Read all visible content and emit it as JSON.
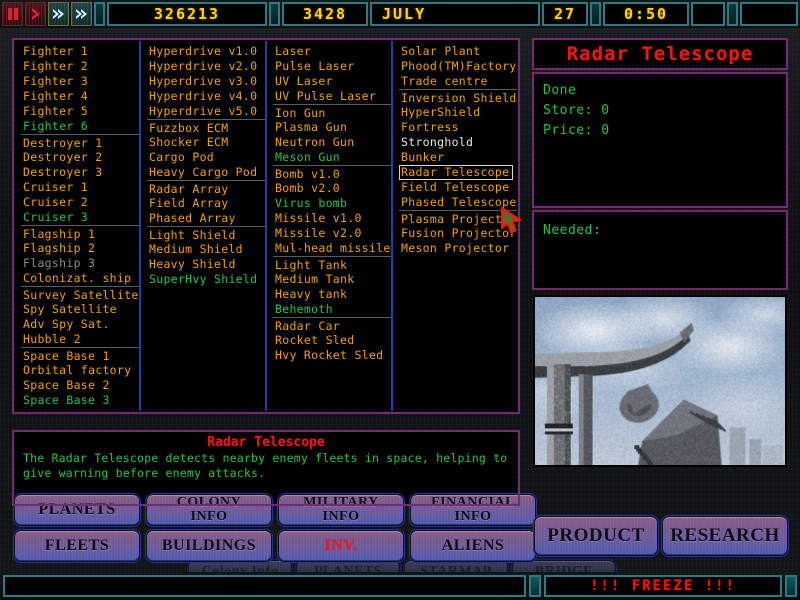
{
  "topbar": {
    "controls": [
      {
        "name": "pause-button",
        "glyph": "pause",
        "style": "red"
      },
      {
        "name": "play-button",
        "glyph": "play",
        "style": "red"
      },
      {
        "name": "fast-forward-button",
        "glyph": "ffwd",
        "style": "teal"
      },
      {
        "name": "very-fast-forward-button",
        "glyph": "ffwd",
        "style": "teal"
      }
    ],
    "credits": "326213",
    "population": "3428",
    "month": "JULY",
    "day": "27",
    "time": "0:50",
    "message": ""
  },
  "list_columns": [
    {
      "name": "ships-column",
      "items": [
        {
          "label": "Fighter 1",
          "state": "available"
        },
        {
          "label": "Fighter 2",
          "state": "available"
        },
        {
          "label": "Fighter 3",
          "state": "available"
        },
        {
          "label": "Fighter 4",
          "state": "available"
        },
        {
          "label": "Fighter 5",
          "state": "available"
        },
        {
          "label": "Fighter 6",
          "state": "researched"
        },
        {
          "label": "Destroyer 1",
          "state": "available",
          "group_start": true
        },
        {
          "label": "Destroyer 2",
          "state": "available"
        },
        {
          "label": "Destroyer 3",
          "state": "available"
        },
        {
          "label": "Cruiser 1",
          "state": "available"
        },
        {
          "label": "Cruiser 2",
          "state": "available"
        },
        {
          "label": "Cruiser 3",
          "state": "researched"
        },
        {
          "label": "Flagship 1",
          "state": "available",
          "group_start": true
        },
        {
          "label": "Flagship 2",
          "state": "available"
        },
        {
          "label": "Flagship 3",
          "state": "locked"
        },
        {
          "label": "Colonizat. ship",
          "state": "available"
        },
        {
          "label": "Survey Satellite",
          "state": "available",
          "group_start": true
        },
        {
          "label": "Spy Satellite",
          "state": "available"
        },
        {
          "label": "Adv Spy Sat.",
          "state": "available"
        },
        {
          "label": "Hubble 2",
          "state": "available"
        },
        {
          "label": "Space Base 1",
          "state": "available",
          "group_start": true
        },
        {
          "label": "Orbital factory",
          "state": "available"
        },
        {
          "label": "Space Base 2",
          "state": "available"
        },
        {
          "label": "Space Base 3",
          "state": "researched"
        }
      ]
    },
    {
      "name": "components-column",
      "items": [
        {
          "label": "Hyperdrive v1.0",
          "state": "available"
        },
        {
          "label": "Hyperdrive v2.0",
          "state": "available"
        },
        {
          "label": "Hyperdrive v3.0",
          "state": "available"
        },
        {
          "label": "Hyperdrive v4.0",
          "state": "available"
        },
        {
          "label": "Hyperdrive v5.0",
          "state": "available"
        },
        {
          "label": "Fuzzbox ECM",
          "state": "available",
          "group_start": true
        },
        {
          "label": "Shocker ECM",
          "state": "available"
        },
        {
          "label": "Cargo Pod",
          "state": "available"
        },
        {
          "label": "Heavy Cargo Pod",
          "state": "available"
        },
        {
          "label": "Radar Array",
          "state": "available",
          "group_start": true
        },
        {
          "label": "Field Array",
          "state": "available"
        },
        {
          "label": "Phased Array",
          "state": "available"
        },
        {
          "label": "Light Shield",
          "state": "available",
          "group_start": true
        },
        {
          "label": "Medium Shield",
          "state": "available"
        },
        {
          "label": "Heavy Shield",
          "state": "available"
        },
        {
          "label": "SuperHvy Shield",
          "state": "researched"
        }
      ]
    },
    {
      "name": "weapons-column",
      "items": [
        {
          "label": "Laser",
          "state": "available"
        },
        {
          "label": "Pulse Laser",
          "state": "available"
        },
        {
          "label": "UV Laser",
          "state": "available"
        },
        {
          "label": "UV Pulse Laser",
          "state": "available"
        },
        {
          "label": "Ion Gun",
          "state": "available",
          "group_start": true
        },
        {
          "label": "Plasma Gun",
          "state": "available"
        },
        {
          "label": "Neutron Gun",
          "state": "available"
        },
        {
          "label": "Meson Gun",
          "state": "researched"
        },
        {
          "label": "Bomb v1.0",
          "state": "available",
          "group_start": true
        },
        {
          "label": "Bomb v2.0",
          "state": "available"
        },
        {
          "label": "Virus bomb",
          "state": "researched"
        },
        {
          "label": "Missile v1.0",
          "state": "available"
        },
        {
          "label": "Missile v2.0",
          "state": "available"
        },
        {
          "label": "Mul-head missile",
          "state": "available"
        },
        {
          "label": "Light Tank",
          "state": "available",
          "group_start": true
        },
        {
          "label": "Medium Tank",
          "state": "available"
        },
        {
          "label": "Heavy tank",
          "state": "available"
        },
        {
          "label": "Behemoth",
          "state": "researched"
        },
        {
          "label": "Radar Car",
          "state": "available",
          "group_start": true
        },
        {
          "label": "Rocket Sled",
          "state": "available"
        },
        {
          "label": "Hvy Rocket Sled",
          "state": "available"
        }
      ]
    },
    {
      "name": "buildings-column",
      "items": [
        {
          "label": "Solar Plant",
          "state": "available"
        },
        {
          "label": "Phood(TM)Factory",
          "state": "available"
        },
        {
          "label": "Trade centre",
          "state": "available"
        },
        {
          "label": "Inversion Shield",
          "state": "available",
          "group_start": true
        },
        {
          "label": "HyperShield",
          "state": "available"
        },
        {
          "label": "Fortress",
          "state": "available"
        },
        {
          "label": "Stronghold",
          "state": "highlighted"
        },
        {
          "label": "Bunker",
          "state": "available"
        },
        {
          "label": "Radar Telescope",
          "state": "selected"
        },
        {
          "label": "Field Telescope",
          "state": "available"
        },
        {
          "label": "Phased Telescope",
          "state": "available"
        },
        {
          "label": "Plasma Project",
          "state": "available",
          "group_start": true
        },
        {
          "label": "Fusion Projector",
          "state": "available"
        },
        {
          "label": "Meson Projector",
          "state": "available"
        }
      ]
    }
  ],
  "description": {
    "title": "Radar Telescope",
    "body": "The Radar Telescope detects nearby enemy fleets in space, helping to give warning before enemy attacks."
  },
  "info_panel": {
    "title": "Radar Telescope",
    "status": "Done",
    "store_label": "Store: 0",
    "price_label": "Price: 0",
    "needed_label": "Needed:",
    "picture_alt": "radar-telescope-render"
  },
  "nav_buttons": [
    {
      "name": "planets-button",
      "label": "PLANETS",
      "lines": [
        "PLANETS"
      ],
      "active": false
    },
    {
      "name": "colony-info-button",
      "label": "COLONY INFO",
      "lines": [
        "COLONY",
        "INFO"
      ],
      "active": false
    },
    {
      "name": "military-info-button",
      "label": "MILITARY INFO",
      "lines": [
        "MILITARY",
        "INFO"
      ],
      "active": false
    },
    {
      "name": "financial-info-button",
      "label": "FINANCIAL INFO",
      "lines": [
        "FINANCIAL",
        "INFO"
      ],
      "active": false
    },
    {
      "name": "fleets-button",
      "label": "FLEETS",
      "lines": [
        "FLEETS"
      ],
      "active": false
    },
    {
      "name": "buildings-button",
      "label": "BUILDINGS",
      "lines": [
        "BUILDINGS"
      ],
      "active": false
    },
    {
      "name": "inventory-button",
      "label": "INV.",
      "lines": [
        "INV."
      ],
      "active": true
    },
    {
      "name": "aliens-button",
      "label": "ALIENS",
      "lines": [
        "ALIENS"
      ],
      "active": false
    }
  ],
  "side_buttons": [
    {
      "name": "product-button",
      "label": "PRODUCT"
    },
    {
      "name": "research-button",
      "label": "RESEARCH"
    }
  ],
  "ghost_buttons": [
    {
      "name": "ghost-colony-info-button",
      "label": "Colony Info"
    },
    {
      "name": "ghost-planets-button",
      "label": "PLANETS"
    },
    {
      "name": "ghost-starmap-button",
      "label": "STARMAP"
    },
    {
      "name": "ghost-bridge-button",
      "label": "BRIDGE"
    }
  ],
  "statusbar": {
    "message": "",
    "freeze": "!!! FREEZE !!!"
  },
  "colors": {
    "item_available": "#f0a000",
    "item_researched": "#23c44a",
    "item_locked": "#8a8a8a",
    "item_highlighted": "#e8e8e8",
    "title_red": "#e01c1c",
    "lcd_yellow": "#ffd21e",
    "panel_border_red": "#c01818",
    "panel_border_blue": "#2040c8",
    "column_divider": "#1e3fa8"
  }
}
